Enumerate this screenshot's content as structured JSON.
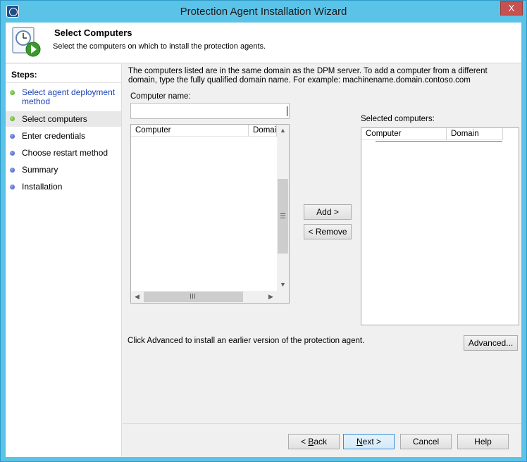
{
  "window": {
    "title": "Protection Agent Installation Wizard",
    "close_glyph": "X"
  },
  "header": {
    "title": "Select Computers",
    "subtitle": "Select the computers on which to install the protection agents."
  },
  "steps": {
    "heading": "Steps:",
    "items": [
      {
        "line1": "Select agent deployment",
        "line2": "method",
        "state": "completed"
      },
      {
        "line1": "Select computers",
        "line2": "",
        "state": "current"
      },
      {
        "line1": "Enter credentials",
        "line2": "",
        "state": "pending"
      },
      {
        "line1": "Choose restart method",
        "line2": "",
        "state": "pending"
      },
      {
        "line1": "Summary",
        "line2": "",
        "state": "pending"
      },
      {
        "line1": "Installation",
        "line2": "",
        "state": "pending"
      }
    ]
  },
  "main": {
    "info_line1": "The computers listed are in the same domain as the DPM server. To add a computer from a different",
    "info_line2": "domain, type the fully qualified domain name. For example: machinename.domain.contoso.com",
    "computer_name_label": "Computer name:",
    "computer_name_value": "",
    "available_list": {
      "columns": [
        "Computer",
        "Domain"
      ],
      "rows": []
    },
    "selected_label": "Selected computers:",
    "selected_list": {
      "columns": [
        "Computer",
        "Domain"
      ],
      "rows": []
    },
    "add_button": "Add >",
    "remove_button": "< Remove",
    "advanced_hint": "Click Advanced to install an earlier version of the protection agent.",
    "advanced_button": "Advanced..."
  },
  "footer": {
    "back": {
      "underlined": "B",
      "rest": "ack",
      "prefix": "< "
    },
    "next": {
      "underlined": "N",
      "rest": "ext >"
    },
    "cancel": "Cancel",
    "help": "Help"
  },
  "colors": {
    "titlebar": "#5cc3e8",
    "close": "#c75050",
    "link": "#1a3fb5",
    "completed_dot": "#4aa01f",
    "pending_dot": "#3b4ccc"
  },
  "icons": {
    "app": "dpm-app-icon",
    "header": "clock-run-icon"
  }
}
